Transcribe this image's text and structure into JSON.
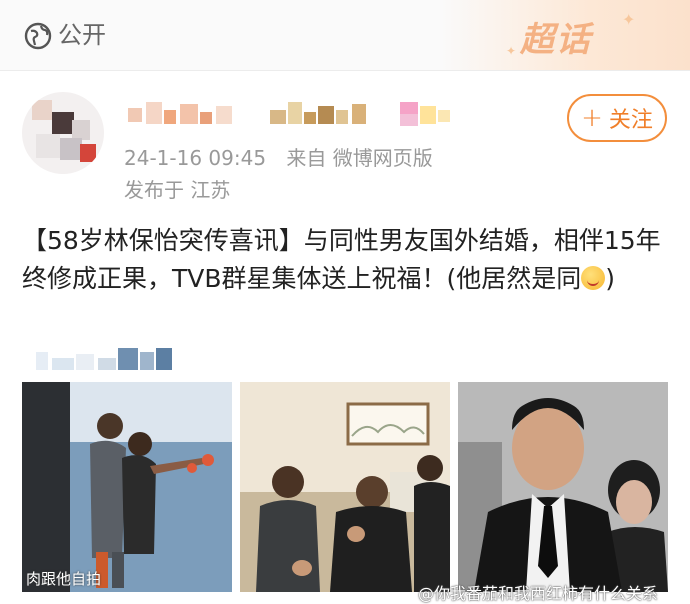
{
  "header": {
    "visibility_label": "公开",
    "supertopic_label": "超话"
  },
  "author": {
    "follow_label": "+ 关注",
    "follow_plus": "+",
    "follow_text": "关注",
    "timestamp": "24-1-16 09:45",
    "source": "来自 微博网页版",
    "location": "发布于 江苏"
  },
  "post": {
    "text": "【58岁林保怡突传喜讯】与同性男友国外结婚，相伴15年终修成正果，TVB群星集体送上祝福！(他居然是同",
    "text_tail": ")"
  },
  "images": {
    "caption_overlay": "肉跟他自拍",
    "watermark": "@你我番茄和我西红柿有什么关系"
  },
  "colors": {
    "accent": "#f07f2a",
    "meta_text": "#999999",
    "body_text": "#222222"
  }
}
